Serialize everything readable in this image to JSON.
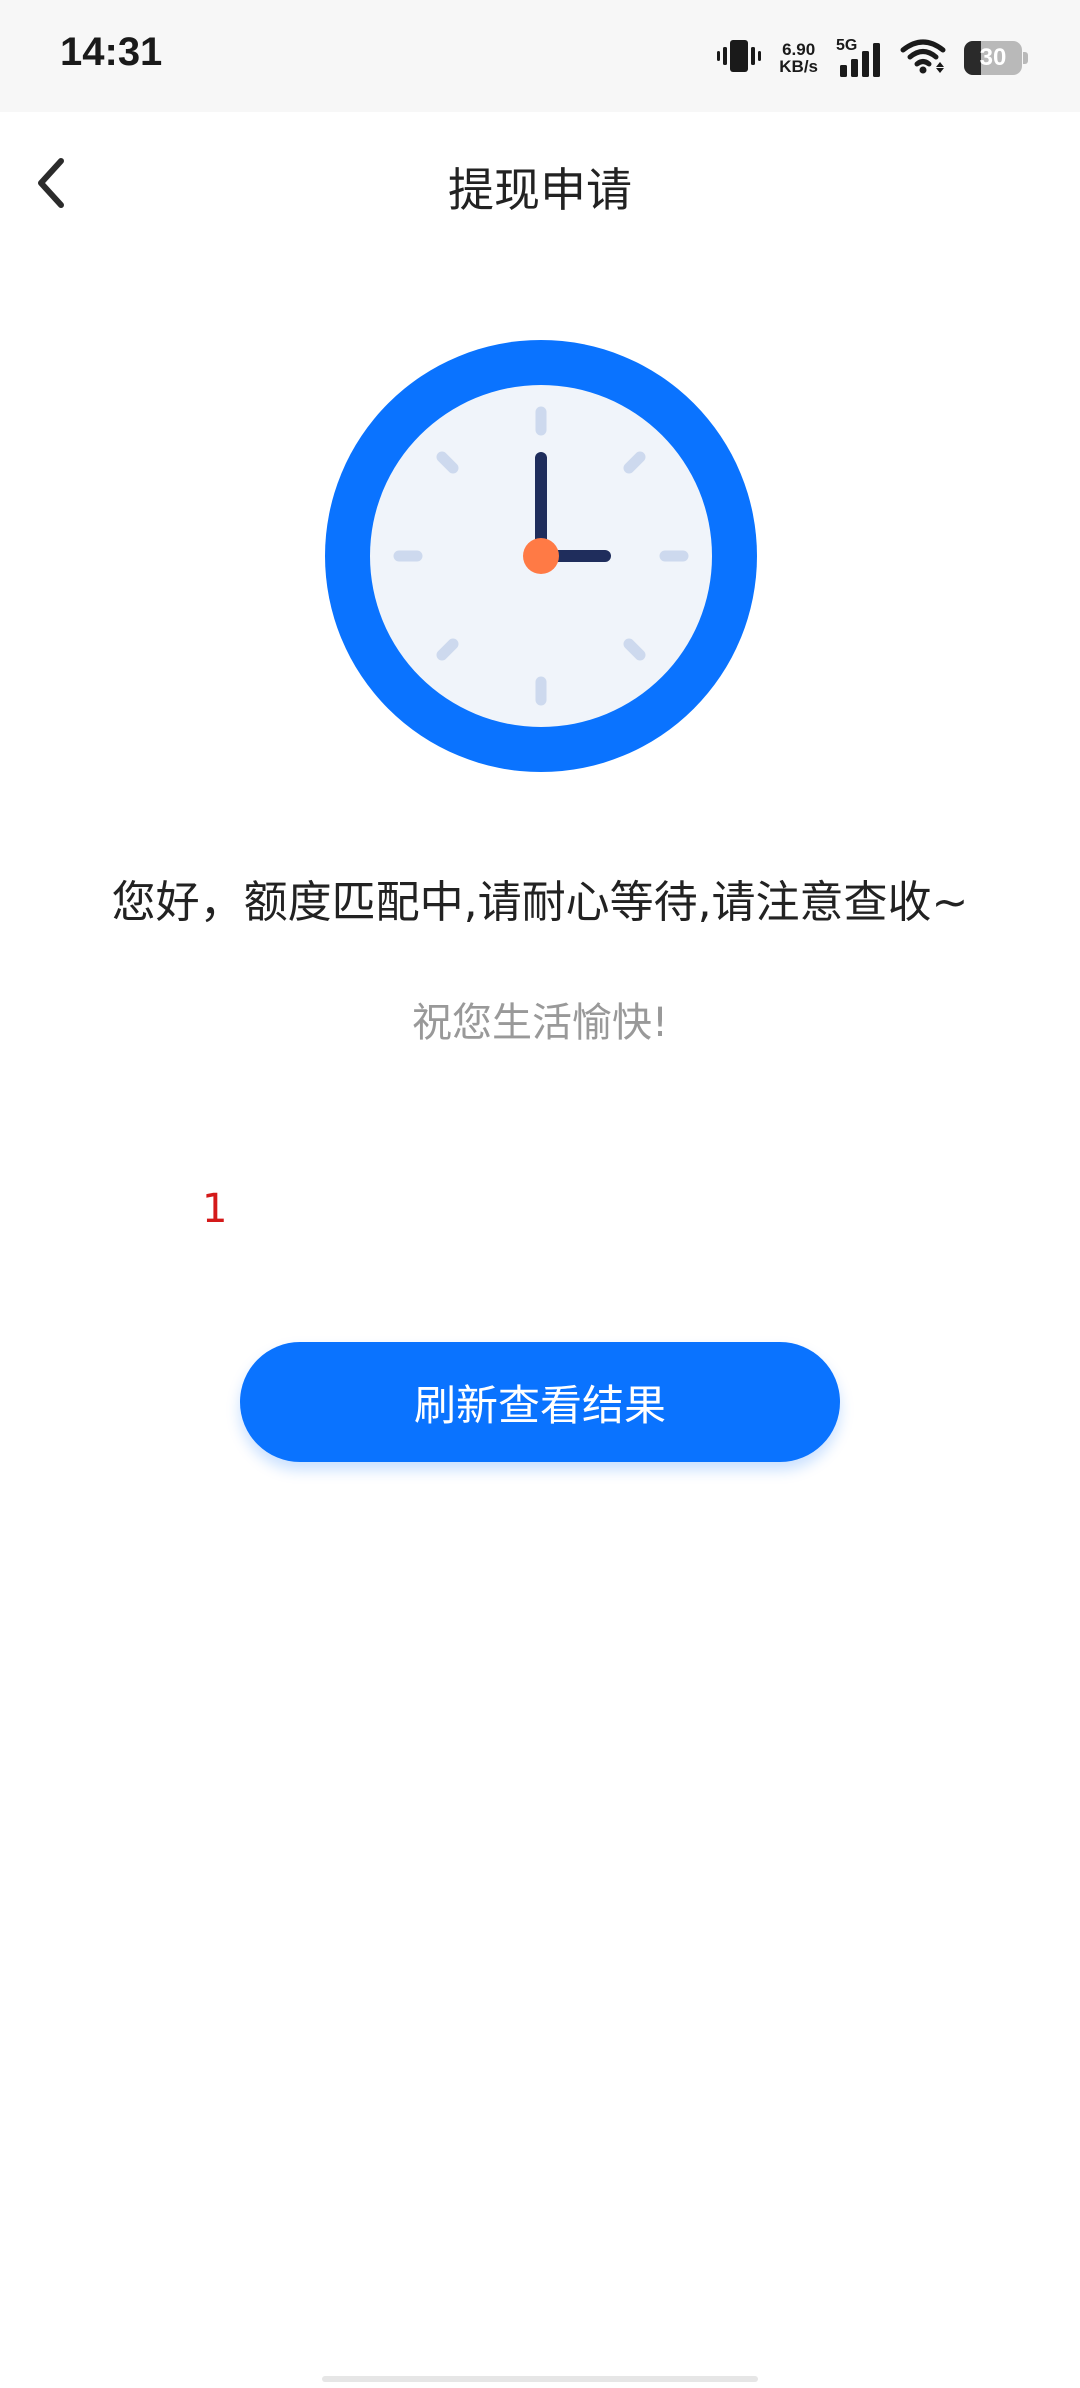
{
  "status_bar": {
    "time": "14:31",
    "net_speed_value": "6.90",
    "net_speed_unit": "KB/s",
    "network_type": "5G",
    "battery_level": "30",
    "icons": [
      "vibrate-icon",
      "signal-icon",
      "wifi-icon",
      "battery-icon"
    ]
  },
  "nav": {
    "title": "提现申请",
    "back_icon": "chevron-left-icon"
  },
  "main": {
    "illustration_icon": "clock-icon",
    "message": "您好，额度匹配中,请耐心等待,请注意查收~",
    "sub_message": "祝您生活愉快!",
    "marker": "1",
    "refresh_button_label": "刷新查看结果"
  },
  "colors": {
    "accent": "#0a73ff",
    "clock_face": "#f0f4fa",
    "clock_hands": "#1f2d5c",
    "clock_center": "#ff7a45",
    "marker": "#d41a1a"
  }
}
